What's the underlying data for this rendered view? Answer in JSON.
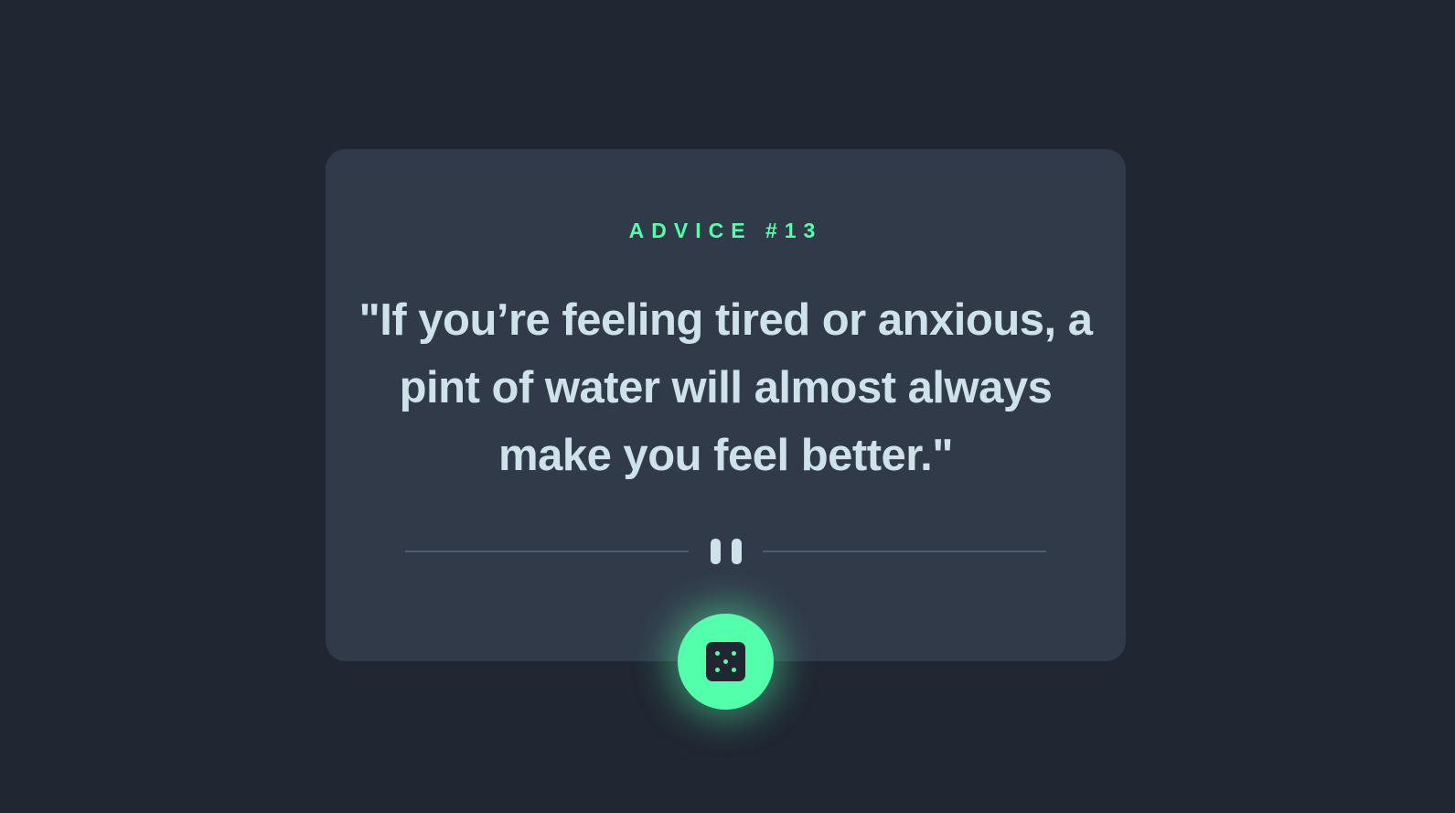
{
  "advice": {
    "label": "ADVICE #13",
    "quote": "\"If you’re feeling tired or anxious, a pint of water will almost always make you feel better.\""
  },
  "divider": {
    "icon": "pause-icon"
  },
  "button": {
    "icon": "dice-icon"
  },
  "colors": {
    "background": "#202632",
    "card": "#313A49",
    "accent": "#53FFAA",
    "text": "#CEE3E9",
    "divider": "#4F5D74"
  }
}
